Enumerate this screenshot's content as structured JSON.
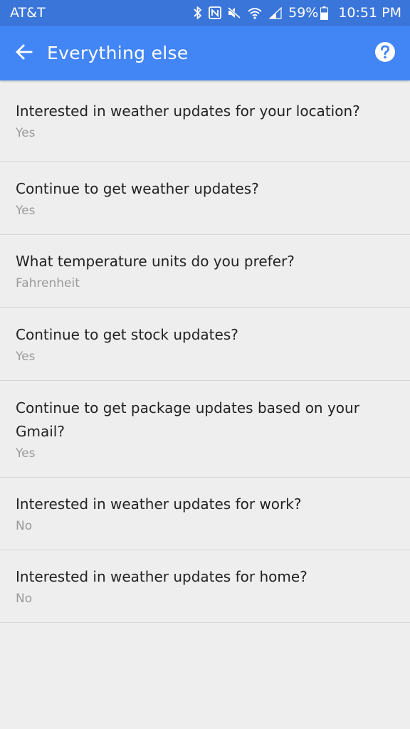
{
  "status_bar": {
    "carrier": "AT&T",
    "battery": "59%",
    "time": "10:51 PM",
    "icons": [
      "bluetooth-icon",
      "nfc-icon",
      "mute-icon",
      "wifi-icon",
      "signal-icon",
      "battery-icon"
    ]
  },
  "header": {
    "title": "Everything else",
    "back_icon": "arrow-back-icon",
    "help_icon": "help-icon"
  },
  "colors": {
    "status_bar": "#3a75d9",
    "app_bar": "#4285f4",
    "background": "#eeeeee",
    "secondary_text": "#9a9a9a"
  },
  "items": [
    {
      "question": "Interested in weather updates for your location?",
      "answer": "Yes"
    },
    {
      "question": "Continue to get weather updates?",
      "answer": "Yes"
    },
    {
      "question": "What temperature units do you prefer?",
      "answer": "Fahrenheit"
    },
    {
      "question": "Continue to get stock updates?",
      "answer": "Yes"
    },
    {
      "question": "Continue to get package updates based on your Gmail?",
      "answer": "Yes"
    },
    {
      "question": "Interested in weather updates for work?",
      "answer": "No"
    },
    {
      "question": "Interested in weather updates for home?",
      "answer": "No"
    }
  ]
}
